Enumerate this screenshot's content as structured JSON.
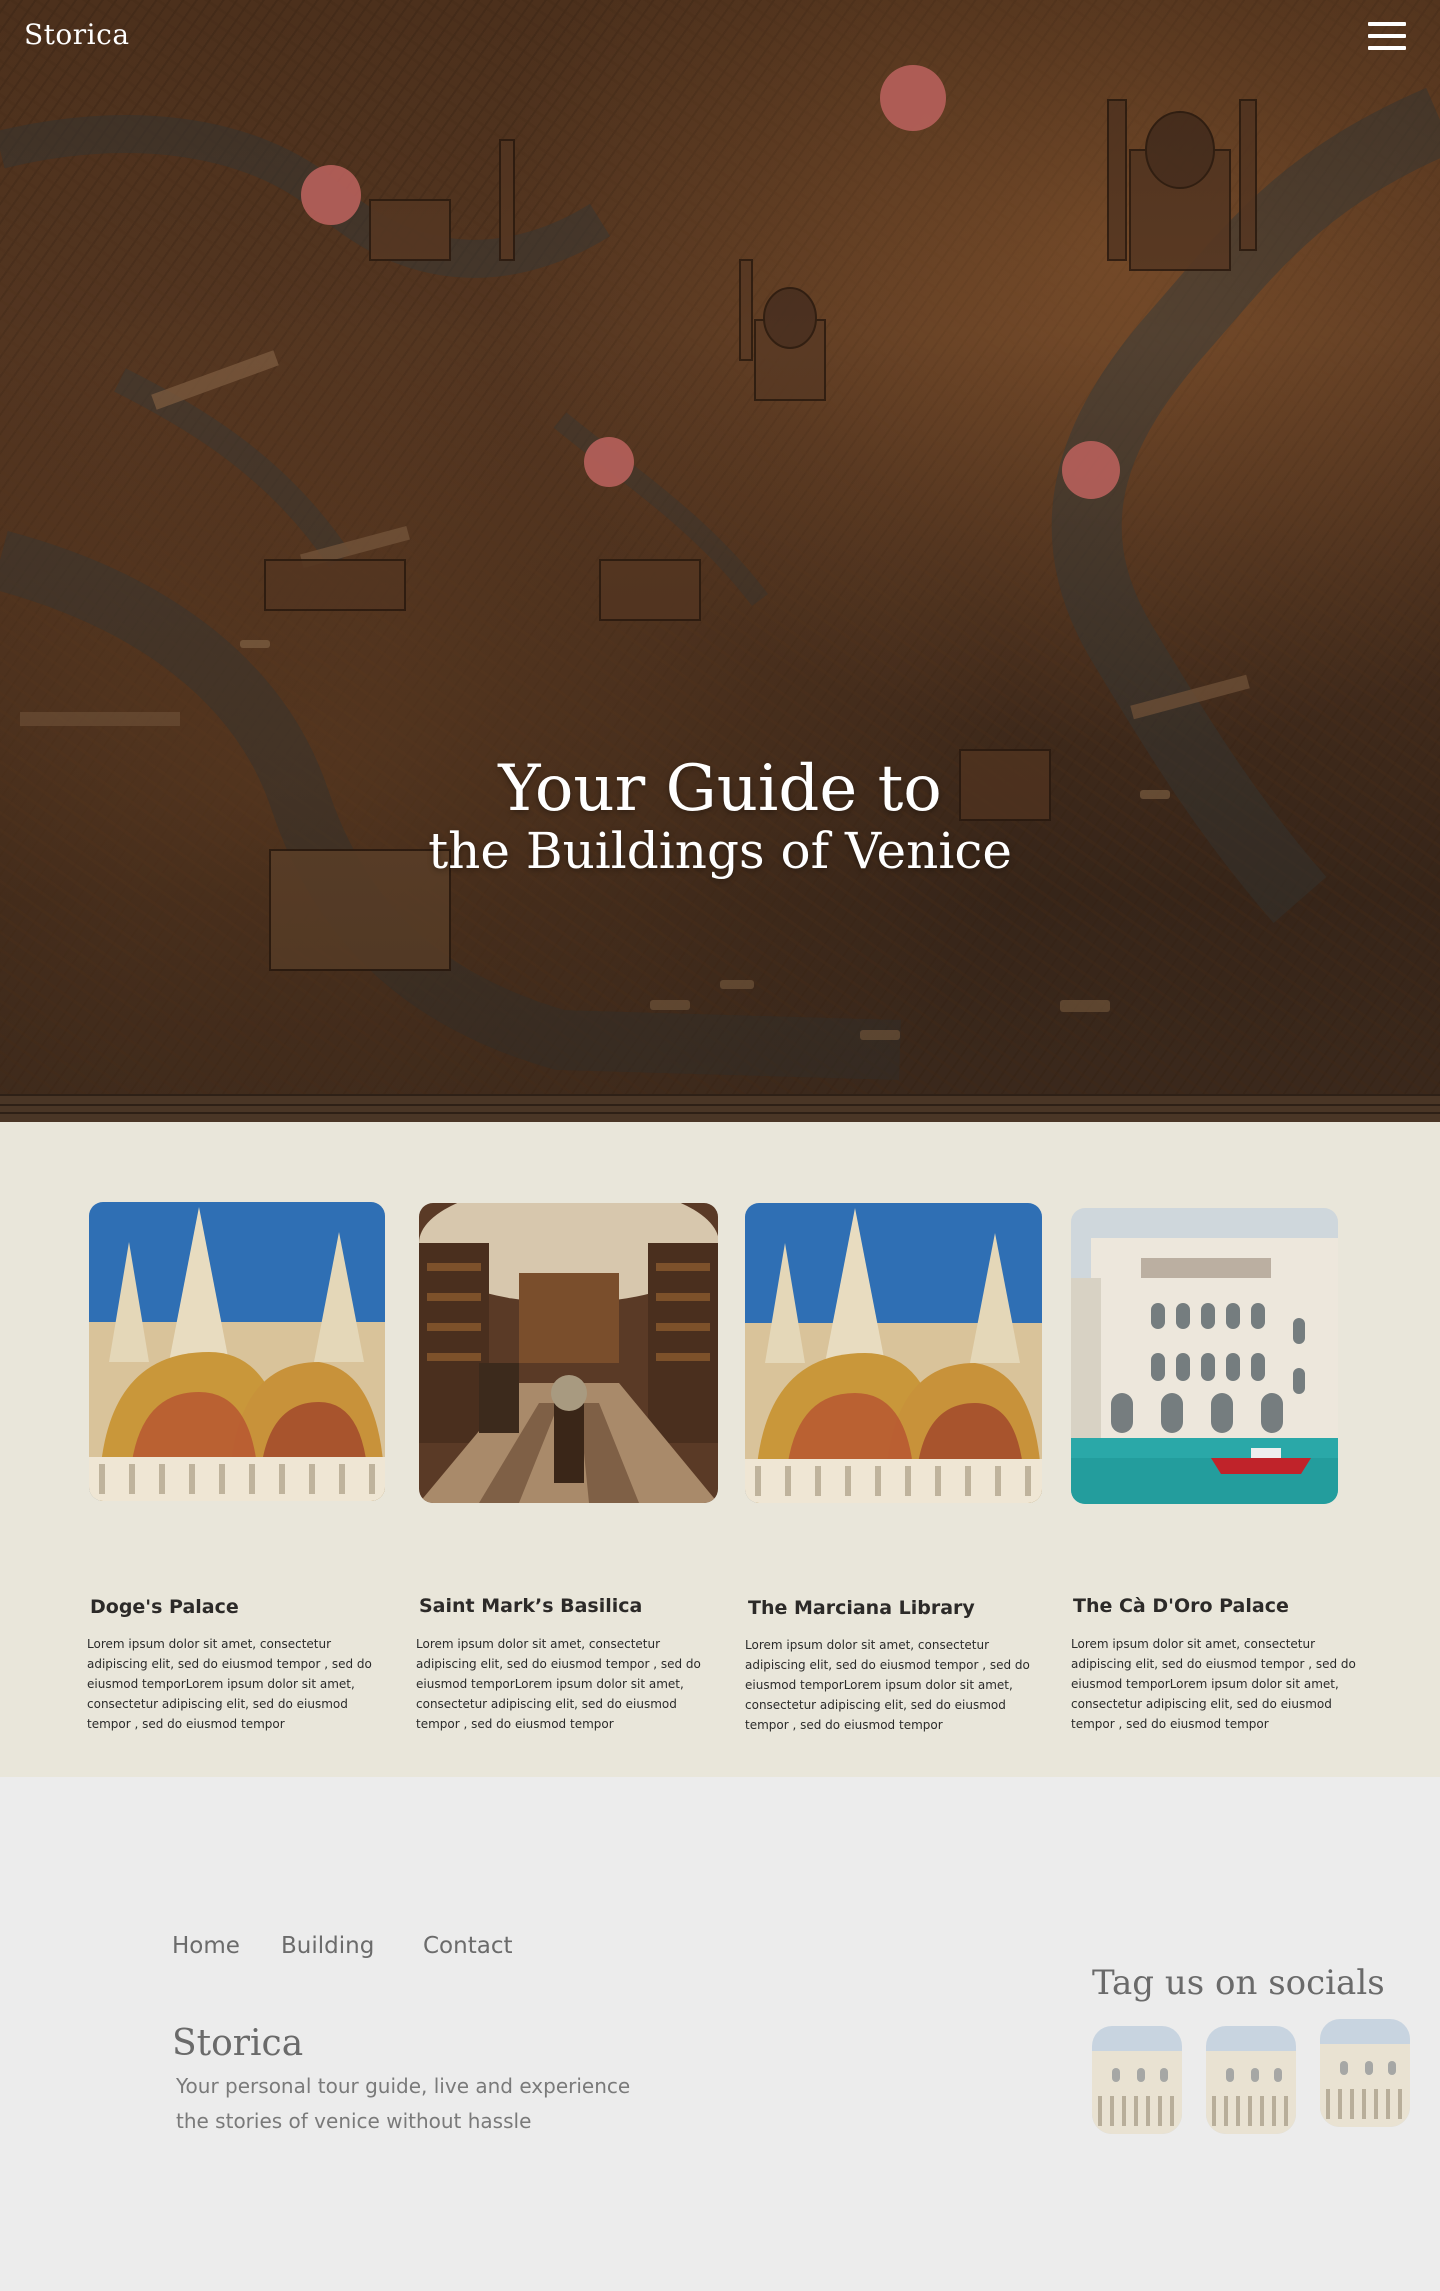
{
  "header": {
    "logo": "Storica",
    "menu_icon": "hamburger-menu-icon"
  },
  "hero": {
    "title_line1": "Your Guide to",
    "title_line2": "the Buildings of Venice",
    "marker_icon": "map-marker-dot",
    "marker_color": "#b5605a"
  },
  "buildings": [
    {
      "title": "Doge's Palace",
      "description": "Lorem ipsum dolor sit amet, consectetur adipiscing elit, sed do eiusmod tempor , sed do eiusmod temporLorem ipsum dolor sit amet, consectetur adipiscing elit, sed do eiusmod tempor , sed do eiusmod tempor",
      "image": "basilica-facade-photo"
    },
    {
      "title": "Saint Mark’s Basilica",
      "description": "Lorem ipsum dolor sit amet, consectetur adipiscing elit, sed do eiusmod tempor , sed do eiusmod temporLorem ipsum dolor sit amet, consectetur adipiscing elit, sed do eiusmod tempor , sed do eiusmod tempor",
      "image": "library-interior-photo"
    },
    {
      "title": "The Marciana Library",
      "description": "Lorem ipsum dolor sit amet, consectetur adipiscing elit, sed do eiusmod tempor , sed do eiusmod temporLorem ipsum dolor sit amet, consectetur adipiscing elit, sed do eiusmod tempor , sed do eiusmod tempor",
      "image": "basilica-facade-photo"
    },
    {
      "title": "The Cà D'Oro Palace",
      "description": "Lorem ipsum dolor sit amet, consectetur adipiscing elit, sed do eiusmod tempor , sed do eiusmod temporLorem ipsum dolor sit amet, consectetur adipiscing elit, sed do eiusmod tempor , sed do eiusmod tempor",
      "image": "canal-palace-photo"
    }
  ],
  "footer": {
    "nav": [
      "Home",
      "Building",
      "Contact"
    ],
    "brand": "Storica",
    "tagline": "Your personal tour guide, live and experience the stories of venice without hassle",
    "social_title": "Tag us on socials",
    "social_images": [
      "doges-palace-thumbnail",
      "doges-palace-thumbnail",
      "doges-palace-thumbnail"
    ]
  },
  "colors": {
    "hero_brown": "#4e321f",
    "cards_bg": "#e9e6da",
    "footer_bg": "#ececec",
    "text_dark": "#2c2a28",
    "text_muted": "#6b6b6b"
  }
}
